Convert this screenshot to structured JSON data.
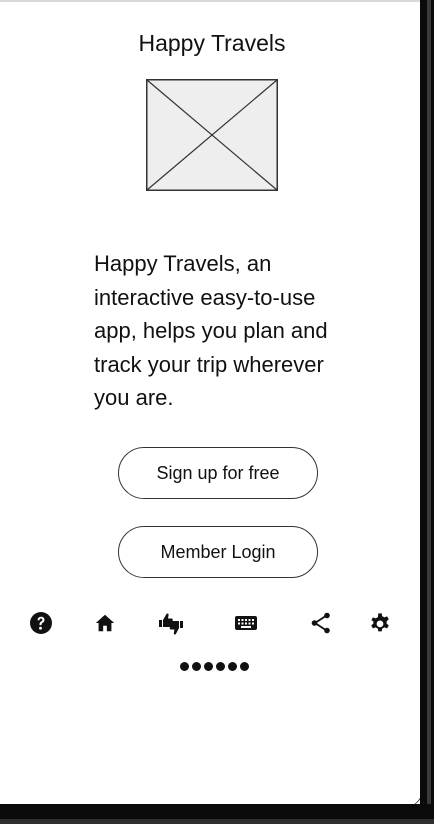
{
  "app": {
    "title": "Happy Travels"
  },
  "hero": {
    "image_placeholder": "image-placeholder",
    "description": "Happy Travels, an interactive easy-to-use app, helps you plan and  track your trip wherever you are."
  },
  "actions": {
    "signup_label": "Sign up for free",
    "login_label": "Member Login"
  },
  "toolbar": {
    "icons": [
      "help-icon",
      "home-icon",
      "thumbs-icon",
      "keyboard-icon",
      "share-icon",
      "settings-icon"
    ]
  },
  "pager": {
    "dot_count": 6
  },
  "colors": {
    "text": "#111111",
    "button_border": "#333333",
    "placeholder_fill": "#eeeeee",
    "bezel": "#0a0a0a"
  }
}
